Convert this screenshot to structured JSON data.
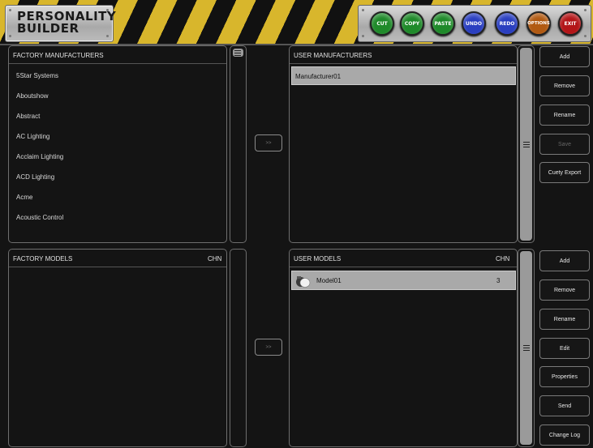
{
  "header": {
    "logo_text": "PERSONALITY BUILDER",
    "toolbar_buttons": [
      {
        "label": "CUT",
        "color": "#1f8a2a"
      },
      {
        "label": "COPY",
        "color": "#1f8a2a"
      },
      {
        "label": "PASTE",
        "color": "#1f8a2a"
      },
      {
        "label": "UNDO",
        "color": "#2a3fc0"
      },
      {
        "label": "REDO",
        "color": "#2a3fc0"
      },
      {
        "label": "OPTIONS",
        "color": "#b15a12"
      },
      {
        "label": "EXIT",
        "color": "#b31518"
      }
    ],
    "stripe_colors": {
      "yellow": "#d8b62c",
      "black": "#111111"
    }
  },
  "factory_manufacturers": {
    "title": "FACTORY MANUFACTURERS",
    "items": [
      "5Star Systems",
      "Aboutshow",
      "Abstract",
      "AC Lighting",
      "Acclaim Lighting",
      "ACD Lighting",
      "Acme",
      "Acoustic Control"
    ]
  },
  "user_manufacturers": {
    "title": "USER MANUFACTURERS",
    "items": [
      "Manufacturer01"
    ],
    "selected_index": 0
  },
  "manufacturer_actions": [
    "Add",
    "Remove",
    "Rename",
    "Save",
    "Cuety Export"
  ],
  "manufacturer_actions_disabled": [
    "Save"
  ],
  "factory_models": {
    "title": "FACTORY MODELS",
    "chn_header": "CHN"
  },
  "user_models": {
    "title": "USER MODELS",
    "chn_header": "CHN",
    "rows": [
      {
        "name": "Model01",
        "chn": "3"
      }
    ]
  },
  "model_actions": [
    "Add",
    "Remove",
    "Rename",
    "Edit",
    "Properties",
    "Send",
    "Change Log"
  ],
  "transfer_label": ">>"
}
